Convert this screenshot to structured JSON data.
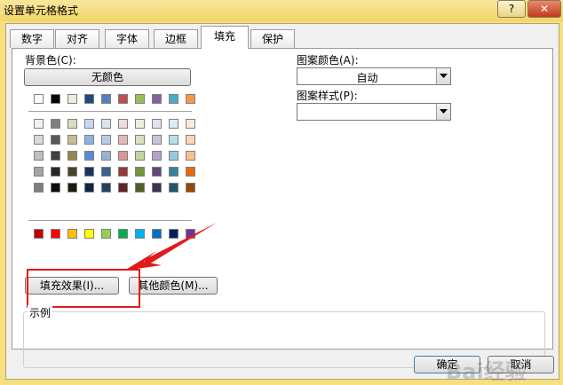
{
  "window": {
    "title": "设置单元格格式",
    "help_label": "?",
    "close_label": "✕"
  },
  "tabs": [
    {
      "label": "数字"
    },
    {
      "label": "对齐"
    },
    {
      "label": "字体"
    },
    {
      "label": "边框"
    },
    {
      "label": "填充"
    },
    {
      "label": "保护"
    }
  ],
  "active_tab": "填充",
  "fill": {
    "background_label": "背景色(C):",
    "no_color_label": "无颜色",
    "fill_effects_label": "填充效果(I)...",
    "more_colors_label": "其他颜色(M)...",
    "pattern_color_label": "图案颜色(A):",
    "pattern_color_value": "自动",
    "pattern_style_label": "图案样式(P):",
    "pattern_style_value": "",
    "sample_label": "示例"
  },
  "palette": {
    "theme_top": [
      "#ffffff",
      "#000000",
      "#eeece1",
      "#1f497d",
      "#4f81bd",
      "#c0504d",
      "#9bbb59",
      "#8064a2",
      "#4bacc6",
      "#f79646"
    ],
    "tints": [
      [
        "#f2f2f2",
        "#7f7f7f",
        "#ddd9c3",
        "#c6d9f0",
        "#dbe5f1",
        "#f2dcdb",
        "#ebf1dd",
        "#e5e0ec",
        "#dbeef3",
        "#fdeada"
      ],
      [
        "#d8d8d8",
        "#595959",
        "#c4bd97",
        "#8db3e2",
        "#b8cce4",
        "#e5b9b7",
        "#d7e3bc",
        "#ccc1d9",
        "#b7dde8",
        "#fbd5b5"
      ],
      [
        "#bfbfbf",
        "#3f3f3f",
        "#938953",
        "#548dd4",
        "#95b3d7",
        "#d99694",
        "#c3d69b",
        "#b2a2c7",
        "#92cddc",
        "#fac08f"
      ],
      [
        "#a5a5a5",
        "#262626",
        "#494429",
        "#17365d",
        "#366092",
        "#953734",
        "#76923c",
        "#5f497a",
        "#31859b",
        "#e36c09"
      ],
      [
        "#7f7f7f",
        "#0c0c0c",
        "#1d1b10",
        "#0f243e",
        "#244061",
        "#632423",
        "#4f6128",
        "#3f3151",
        "#205867",
        "#974806"
      ]
    ],
    "standard": [
      "#c00000",
      "#ff0000",
      "#ffc000",
      "#ffff00",
      "#92d050",
      "#00b050",
      "#00b0f0",
      "#0070c0",
      "#002060",
      "#7030a0"
    ]
  },
  "footer": {
    "ok_label": "确定",
    "cancel_label": "取消"
  },
  "colors": {
    "title_bar": "#f1d46a",
    "annotation_red": "#e31a1a"
  },
  "watermark": "Bai经验"
}
